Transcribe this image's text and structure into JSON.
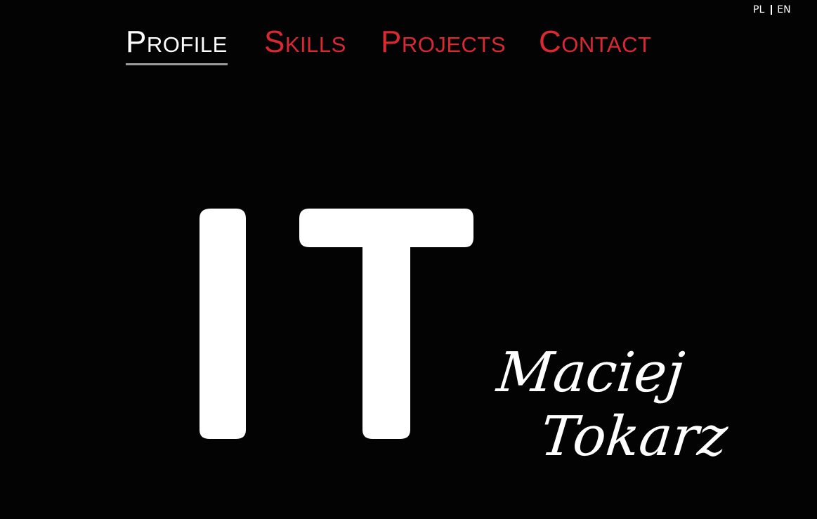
{
  "language_switch": {
    "pl_label": "PL",
    "en_label": "EN",
    "active": "EN"
  },
  "nav": {
    "active_item": "profile",
    "items": [
      {
        "id": "profile",
        "label": "Profile"
      },
      {
        "id": "skills",
        "label": "Skills"
      },
      {
        "id": "projects",
        "label": "Projects"
      },
      {
        "id": "contact",
        "label": "Contact"
      }
    ]
  },
  "hero": {
    "logo_text": "IT",
    "name_first": "Maciej",
    "name_last": "Tokarz"
  },
  "colors": {
    "background": "#030303",
    "accent": "#dc2830",
    "active_nav": "#ffffff",
    "active_underline": "#9a9a9a"
  }
}
